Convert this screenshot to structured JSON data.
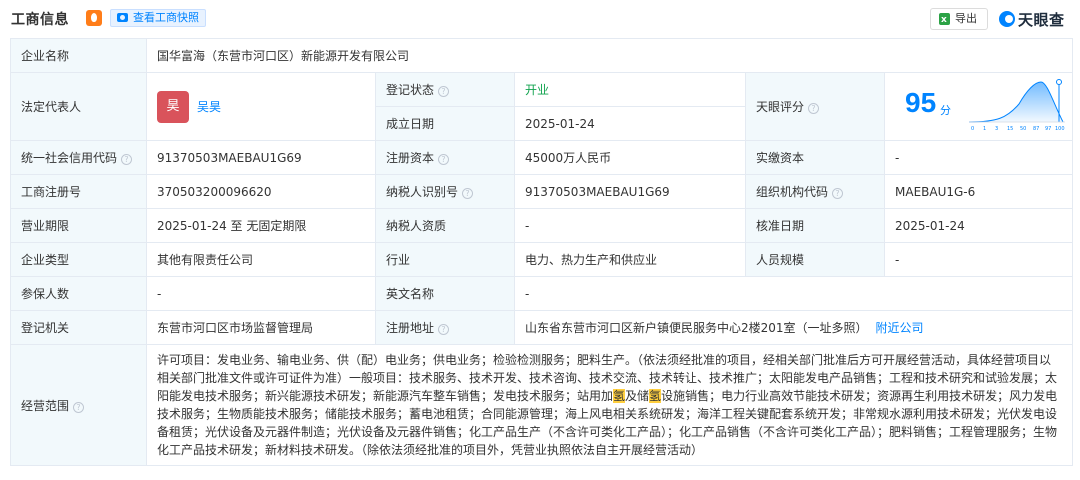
{
  "header": {
    "title": "工商信息",
    "fire_icon": "fire-icon",
    "snapshot_label": "查看工商快照",
    "export_label": "导出",
    "logo_text": "天眼查"
  },
  "colors": {
    "accent": "#0084FF",
    "label_bg": "#F2F9FC",
    "border": "#E4EAF2",
    "status_green": "#12A34F",
    "avatar_bg": "#D9535B"
  },
  "company_name": {
    "label": "企业名称",
    "value": "国华富海（东营市河口区）新能源开发有限公司"
  },
  "legal_rep": {
    "label": "法定代表人",
    "avatar_char": "昊",
    "name": "吴昊"
  },
  "reg_status": {
    "label": "登记状态",
    "value": "开业"
  },
  "established": {
    "label": "成立日期",
    "value": "2025-01-24"
  },
  "score": {
    "label": "天眼评分",
    "value": "95",
    "unit": "分",
    "axis_ticks": [
      "0",
      "1",
      "3",
      "15",
      "50",
      "87",
      "97",
      "100"
    ]
  },
  "credit_code": {
    "label": "统一社会信用代码",
    "value": "91370503MAEBAU1G69"
  },
  "reg_capital": {
    "label": "注册资本",
    "value": "45000万人民币"
  },
  "paid_capital": {
    "label": "实缴资本",
    "value": "-"
  },
  "biz_reg_no": {
    "label": "工商注册号",
    "value": "370503200096620"
  },
  "tax_id": {
    "label": "纳税人识别号",
    "value": "91370503MAEBAU1G69"
  },
  "org_code": {
    "label": "组织机构代码",
    "value": "MAEBAU1G-6"
  },
  "biz_period": {
    "label": "营业期限",
    "value": "2025-01-24 至 无固定期限"
  },
  "tax_qual": {
    "label": "纳税人资质",
    "value": "-"
  },
  "approval_date": {
    "label": "核准日期",
    "value": "2025-01-24"
  },
  "company_type": {
    "label": "企业类型",
    "value": "其他有限责任公司"
  },
  "industry": {
    "label": "行业",
    "value": "电力、热力生产和供应业"
  },
  "staff_size": {
    "label": "人员规模",
    "value": "-"
  },
  "insured": {
    "label": "参保人数",
    "value": "-"
  },
  "english_name": {
    "label": "英文名称",
    "value": "-"
  },
  "reg_authority": {
    "label": "登记机关",
    "value": "东营市河口区市场监督管理局"
  },
  "reg_address": {
    "label": "注册地址",
    "value": "山东省东营市河口区新户镇便民服务中心2楼201室（一址多照）",
    "nearby_link": "附近公司"
  },
  "scope": {
    "label": "经营范围",
    "text_before_hl1": "许可项目：发电业务、输电业务、供（配）电业务；供电业务；检验检测服务；肥料生产。（依法须经批准的项目，经相关部门批准后方可开展经营活动，具体经营项目以相关部门批准文件或许可证件为准）一般项目：技术服务、技术开发、技术咨询、技术交流、技术转让、技术推广；太阳能发电产品销售；工程和技术研究和试验发展；太阳能发电技术服务；新兴能源技术研发；新能源汽车整车销售；发电技术服务；站用加",
    "hl1": "氢",
    "text_mid": "及储",
    "hl2": "氢",
    "text_after_hl2": "设施销售；电力行业高效节能技术研发；资源再生利用技术研发；风力发电技术服务；生物质能技术服务；储能技术服务；蓄电池租赁；合同能源管理；海上风电相关系统研发；海洋工程关键配套系统开发；非常规水源利用技术研发；光伏发电设备租赁；光伏设备及元器件制造；光伏设备及元器件销售；化工产品生产（不含许可类化工产品）；化工产品销售（不含许可类化工产品）；肥料销售；工程管理服务；生物化工产品技术研发；新材料技术研发。（除依法须经批准的项目外，凭营业执照依法自主开展经营活动）"
  }
}
